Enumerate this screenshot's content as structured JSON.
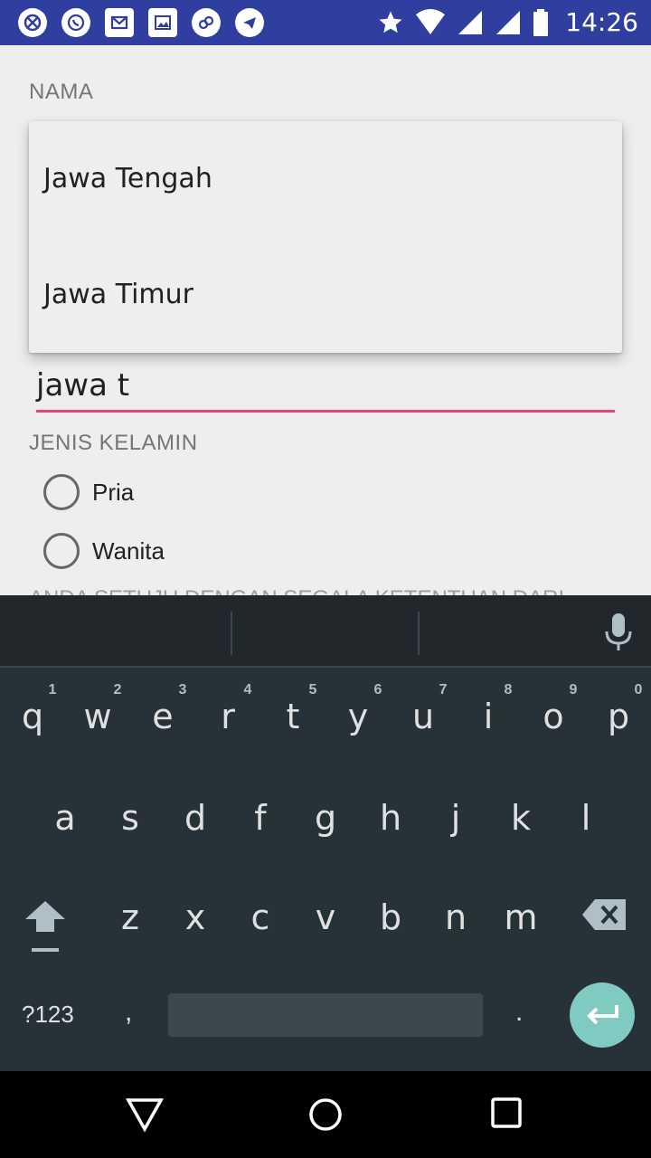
{
  "status_bar": {
    "time": "14:26",
    "left_icons": [
      "ban-icon",
      "whatsapp-icon",
      "gmail-icon",
      "gallery-icon",
      "link-icon",
      "telegram-icon"
    ],
    "right_icons": [
      "star-icon",
      "wifi-icon",
      "signal-icon",
      "signal-icon",
      "battery-icon"
    ],
    "color": "#303f9f"
  },
  "form": {
    "nama_label": "NAMA",
    "input_value": "jawa t",
    "accent_color": "#ec407a",
    "jenis_kelamin_label": "JENIS KELAMIN",
    "radio_options": [
      "Pria",
      "Wanita"
    ],
    "agreement_text": "ANDA SETUJU DENGAN SEGALA KETENTUAN DARI"
  },
  "dropdown": {
    "items": [
      "Jawa Tengah",
      "Jawa Timur"
    ]
  },
  "keyboard": {
    "row1": [
      "q",
      "w",
      "e",
      "r",
      "t",
      "y",
      "u",
      "i",
      "o",
      "p"
    ],
    "row1_hints": [
      "1",
      "2",
      "3",
      "4",
      "5",
      "6",
      "7",
      "8",
      "9",
      "0"
    ],
    "row2": [
      "a",
      "s",
      "d",
      "f",
      "g",
      "h",
      "j",
      "k",
      "l"
    ],
    "row3": [
      "z",
      "x",
      "c",
      "v",
      "b",
      "n",
      "m"
    ],
    "symbols_key": "?123",
    "comma_key": ",",
    "period_key": ".",
    "enter_color": "#7fcbc1"
  },
  "nav": {
    "buttons": [
      "back-icon",
      "home-icon",
      "recents-icon"
    ]
  }
}
